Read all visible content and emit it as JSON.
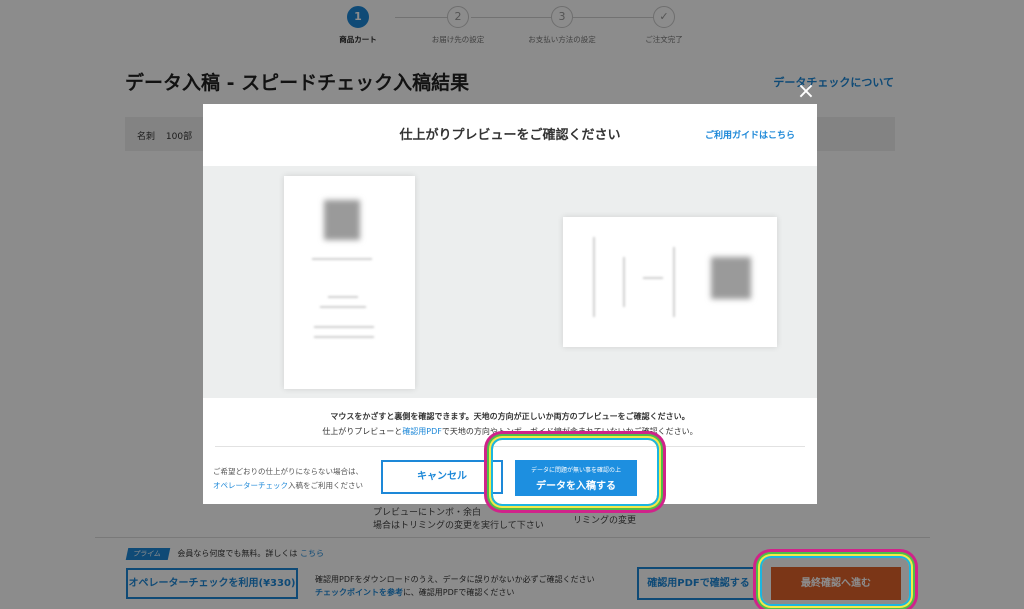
{
  "stepper": {
    "steps": [
      {
        "number": "1",
        "label": "商品カート"
      },
      {
        "number": "2",
        "label": "お届け先の設定"
      },
      {
        "number": "3",
        "label": "お支払い方法の設定"
      },
      {
        "number": "✓",
        "label": "ご注文完了"
      }
    ]
  },
  "page": {
    "title": "データ入稿 - スピードチェック入稿結果",
    "data_check_link": "データチェックについて",
    "info_label": "名刺",
    "info_value": "100部"
  },
  "behind": {
    "line1": "プレビューにトンボ・余白",
    "line2": "場合はトリミングの変更を実行して下さい",
    "right_text": "リミングの変更"
  },
  "bottom_bar": {
    "prime_badge": "プライム",
    "prime_text": "会員なら何度でも無料。詳しくは",
    "prime_link": "こちら",
    "operator_button": "オペレーターチェックを利用(¥330)",
    "note_line1": "確認用PDFをダウンロードのうえ、データに誤りがないか必ずご確認ください",
    "note_link": "チェックポイントを参考",
    "note_line2_rest": "に、確認用PDFで確認ください",
    "pdf_button": "確認用PDFで確認する",
    "final_button": "最終確認へ進む"
  },
  "modal": {
    "close_icon": "×",
    "title": "仕上がりプレビューをご確認ください",
    "guide_link": "ご利用ガイドはこちら",
    "note_line1": "マウスをかざすと裏側を確認できます。天地の方向が正しいか両方のプレビューをご確認ください。",
    "note_line2_pre": "仕上がりプレビューと",
    "note_line2_link": "確認用PDF",
    "note_line2_post": "で天地の方向やトンボ、ガイド線が含まれていないかご確認ください。",
    "hint_line1": "ご希望どおりの仕上がりにならない場合は、",
    "hint_link": "オペレーターチェック",
    "hint_line2_post": "入稿をご利用ください",
    "cancel_button": "キャンセル",
    "submit_sub": "データに問題が無い事を確認の上",
    "submit_main": "データを入稿する"
  },
  "colors": {
    "accent": "#1d88d8",
    "final_button": "#e0632a",
    "highlight_outer": "#d0238a",
    "highlight_mid": "#4fbe49",
    "highlight_yellow": "#f4e94a",
    "highlight_inner": "#1bb6e0"
  }
}
